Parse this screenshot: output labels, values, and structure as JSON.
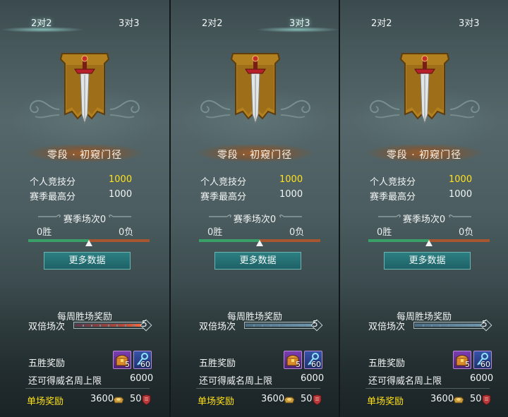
{
  "panels": [
    {
      "tabs": [
        {
          "label": "2对2",
          "active": true
        },
        {
          "label": "3对3",
          "active": false
        }
      ],
      "rank_name": "零段 · 初窥门径",
      "personal_score_label": "个人竞技分",
      "personal_score": "1000",
      "season_high_label": "赛季最高分",
      "season_high": "1000",
      "season_matches": "赛季场次0",
      "wins": "0胜",
      "losses": "0负",
      "win_ratio": 0.5,
      "more_data": "更多数据",
      "weekly_title": "每周胜场奖励",
      "double_label": "双倍场次",
      "double_count": "5",
      "double_fill": 1.0,
      "double_fill_style": "red",
      "five_win_label": "五胜奖励",
      "reward_items": [
        {
          "icon": "treasure-chest-icon",
          "count": "5"
        },
        {
          "icon": "key-icon",
          "count": "60"
        }
      ],
      "fame_cap_label": "还可得威名周上限",
      "fame_cap": "6000",
      "single_label": "单场奖励",
      "single_gold": "3600",
      "single_fame": "50"
    },
    {
      "tabs": [
        {
          "label": "2对2",
          "active": false
        },
        {
          "label": "3对3",
          "active": true
        }
      ],
      "rank_name": "零段 · 初窥门径",
      "personal_score_label": "个人竞技分",
      "personal_score": "1000",
      "season_high_label": "赛季最高分",
      "season_high": "1000",
      "season_matches": "赛季场次0",
      "wins": "0胜",
      "losses": "0负",
      "win_ratio": 0.5,
      "more_data": "更多数据",
      "weekly_title": "每周胜场奖励",
      "double_label": "双倍场次",
      "double_count": "5",
      "double_fill": 1.0,
      "double_fill_style": "blue",
      "five_win_label": "五胜奖励",
      "reward_items": [
        {
          "icon": "treasure-chest-icon",
          "count": "5"
        },
        {
          "icon": "key-icon",
          "count": "60"
        }
      ],
      "fame_cap_label": "还可得威名周上限",
      "fame_cap": "6000",
      "single_label": "单场奖励",
      "single_gold": "3600",
      "single_fame": "50"
    },
    {
      "tabs": [
        {
          "label": "2对2",
          "active": false
        },
        {
          "label": "3对3",
          "active": false
        }
      ],
      "rank_name": "零段 · 初窥门径",
      "personal_score_label": "个人竞技分",
      "personal_score": "1000",
      "season_high_label": "赛季最高分",
      "season_high": "1000",
      "season_matches": "赛季场次0",
      "wins": "0胜",
      "losses": "0负",
      "win_ratio": 0.5,
      "more_data": "更多数据",
      "weekly_title": "每周胜场奖励",
      "double_label": "双倍场次",
      "double_count": "5",
      "double_fill": 1.0,
      "double_fill_style": "blue",
      "five_win_label": "五胜奖励",
      "reward_items": [
        {
          "icon": "treasure-chest-icon",
          "count": "5"
        },
        {
          "icon": "key-icon",
          "count": "60"
        }
      ],
      "fame_cap_label": "还可得威名周上限",
      "fame_cap": "6000",
      "single_label": "单场奖励",
      "single_gold": "3600",
      "single_fame": "50"
    }
  ],
  "colors": {
    "gold_text": "#ffe21a",
    "win_bar": "#3aa06a",
    "loss_bar": "#a8562f",
    "button": "#2d7f82",
    "banner": "#b3801f"
  }
}
